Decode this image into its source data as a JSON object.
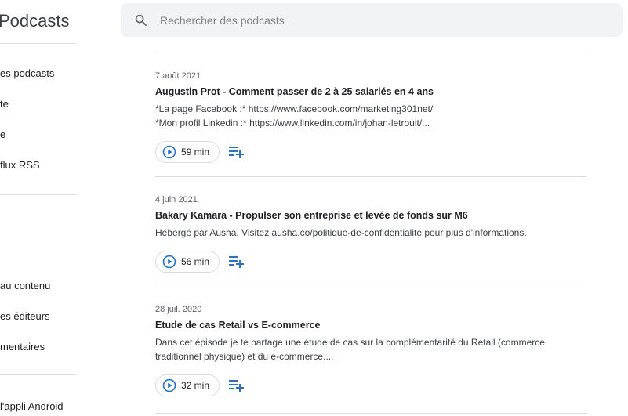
{
  "app": {
    "title": "Podcasts"
  },
  "sidebar": {
    "items": [
      {
        "label": "es podcasts"
      },
      {
        "label": "te"
      },
      {
        "label": "e"
      },
      {
        "label": "flux RSS"
      },
      {
        "label": "au contenu"
      },
      {
        "label": "es éditeurs"
      },
      {
        "label": "mentaires"
      },
      {
        "label": "l'appli Android"
      }
    ]
  },
  "search": {
    "placeholder": "Rechercher des podcasts",
    "value": ""
  },
  "episodes": [
    {
      "date": "7 août 2021",
      "title": "Augustin Prot - Comment passer de 2 à 25 salariés en 4 ans",
      "desc_lines": [
        "*La page Facebook :* https://www.facebook.com/marketing301net/",
        "*Mon profil Linkedin :* https://www.linkedin.com/in/johan-letrouit/..."
      ],
      "duration": "59 min"
    },
    {
      "date": "4 juin 2021",
      "title": "Bakary Kamara - Propulser son entreprise et levée de fonds sur M6",
      "desc_lines": [
        "Hébergé par Ausha. Visitez ausha.co/politique-de-confidentialite pour plus d'informations."
      ],
      "duration": "56 min"
    },
    {
      "date": "28 juil. 2020",
      "title": "Etude de cas Retail vs E-commerce",
      "desc_lines": [
        "Dans cet épisode je te partage une étude de cas sur la complémentarité du Retail (commerce",
        "traditionnel physique) et du e-commerce...."
      ],
      "duration": "32 min"
    }
  ],
  "colors": {
    "accent": "#1a73e8",
    "divider": "#dadce0",
    "search_bg": "#f1f3f4"
  }
}
